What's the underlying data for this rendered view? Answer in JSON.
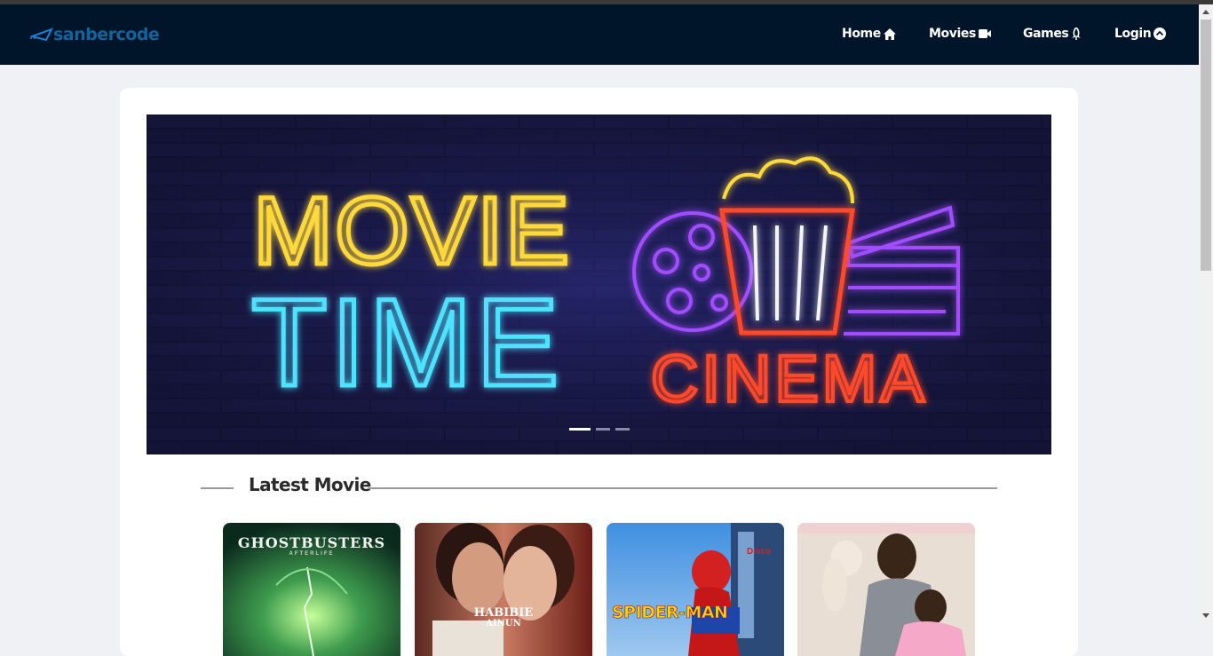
{
  "brand": {
    "logo_text": "sanbercode",
    "logo_icon": "airplane-icon"
  },
  "nav": [
    {
      "label": "Home",
      "icon": "home-icon"
    },
    {
      "label": "Movies",
      "icon": "video-camera-icon"
    },
    {
      "label": "Games",
      "icon": "rocket-icon"
    },
    {
      "label": "Login",
      "icon": "up-circle-icon"
    }
  ],
  "banner": {
    "line1": "MOVIE",
    "line2": "TIME",
    "line3": "CINEMA",
    "slides": 3,
    "active_slide": 1
  },
  "section": {
    "title": "Latest Movie"
  },
  "movies": [
    {
      "poster_title": "GHOSTBUSTERS",
      "poster_subtitle": "AFTERLIFE"
    },
    {
      "poster_title": "HABIBIE",
      "poster_subtitle": "AINUN"
    },
    {
      "poster_title": "SPIDER-MAN",
      "poster_subtitle": ""
    },
    {
      "poster_title": "",
      "poster_subtitle": ""
    }
  ],
  "colors": {
    "navbar": "#001529",
    "logo": "#15639b",
    "neon_yellow": "#ffd93a",
    "neon_cyan": "#4fe2ff",
    "neon_red": "#ff4a2a",
    "neon_purple": "#a14dff"
  }
}
